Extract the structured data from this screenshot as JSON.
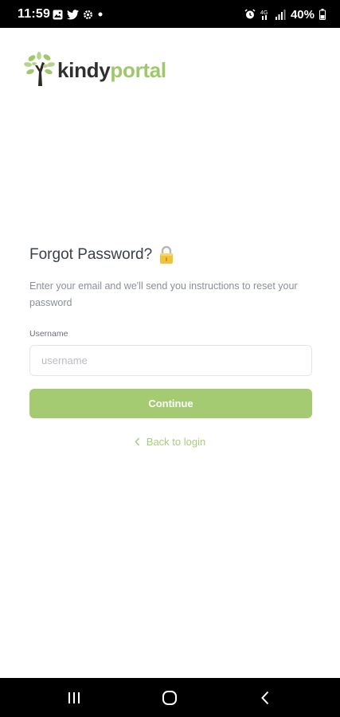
{
  "status_bar": {
    "time": "11:59",
    "battery_percent": "40%",
    "left_icons": [
      "image-icon",
      "twitter-icon",
      "settings-icon",
      "dot-icon"
    ],
    "right_icons": [
      "alarm-icon",
      "wifi-calling-icon",
      "signal-icon",
      "battery-icon"
    ]
  },
  "logo": {
    "part1": "kindy",
    "part2": "portal",
    "brand_dark": "#2f2f2f",
    "brand_green": "#9fc86a"
  },
  "form": {
    "title": "Forgot Password?",
    "title_icon": "lock-icon",
    "instructions": "Enter your email and we'll send you instructions to reset your password",
    "username_label": "Username",
    "username_placeholder": "username",
    "username_value": "",
    "continue_label": "Continue",
    "back_label": "Back to login",
    "accent_color": "#a5cb72"
  },
  "nav_bar": {
    "buttons": [
      "recent-apps-icon",
      "home-icon",
      "back-icon"
    ]
  }
}
